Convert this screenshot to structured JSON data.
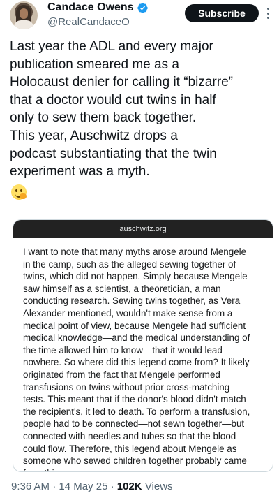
{
  "author": {
    "name": "Candace Owens",
    "handle": "@RealCandaceO",
    "verified_icon": "verified-badge-icon"
  },
  "actions": {
    "subscribe_label": "Subscribe",
    "more_icon": "more-options-icon"
  },
  "tweet": {
    "text": "Last year the ADL and every major\npublication smeared me as a\nHolocaust denier for calling it “bizarre”\nthat a doctor would cut twins in half\nonly to sew them back together.\nThis year,  Auschwitz drops a\npodcast substantiating that the twin\nexperiment was a myth.",
    "emoji_icon": "hugging-face-emoji-icon"
  },
  "quote_card": {
    "source": "auschwitz.org",
    "body": "I want to note that many myths arose around Mengele\nin the camp, such as the alleged sewing together of\ntwins, which did not happen. Simply because Mengele\nsaw himself as a scientist, a theoretician, a man\nconducting research. Sewing twins together, as Vera\nAlexander mentioned, wouldn't make sense from a\nmedical point of view, because Mengele had sufficient\nmedical knowledge—and the medical understanding of\nthe time allowed him to know—that it would lead\nnowhere. So where did this legend come from? It likely\noriginated from the fact that Mengele performed\ntransfusions on twins without prior cross-matching\ntests. This meant that if the donor's blood didn't match\nthe recipient's, it led to death. To perform a transfusion,\npeople had to be connected—not sewn together—but\nconnected with needles and tubes so that the blood\ncould flow. Therefore, this legend about Mengele as\nsomeone who sewed children together probably came\nfrom this."
  },
  "meta": {
    "time": "9:36 AM",
    "separator": "·",
    "date": "14 May 25",
    "views_count": "102K",
    "views_label": "Views"
  },
  "colors": {
    "text_primary": "#0f1419",
    "text_secondary": "#536471",
    "verified_blue": "#1d9bf0",
    "button_bg": "#0f1419",
    "card_header_bg": "#222222"
  }
}
